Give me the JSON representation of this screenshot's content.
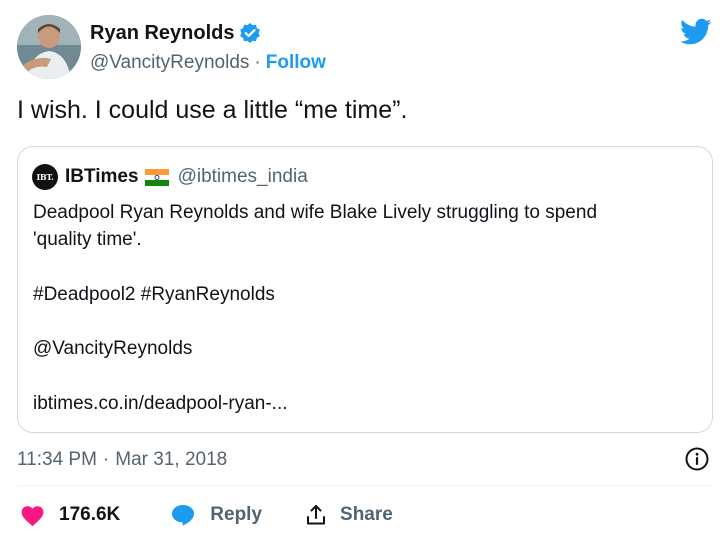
{
  "author": {
    "display_name": "Ryan Reynolds",
    "handle": "@VancityReynolds",
    "separator": "·",
    "follow_label": "Follow"
  },
  "tweet": {
    "text": "I wish. I could use a little “me time”."
  },
  "quoted": {
    "logo_text": "IBT.",
    "name": "IBTimes",
    "handle": "@ibtimes_india",
    "line1": "Deadpool Ryan Reynolds and wife Blake Lively struggling to spend",
    "line2": "'quality time'.",
    "hashtags": "#Deadpool2 #RyanReynolds",
    "mention": "@VancityReynolds",
    "link": "ibtimes.co.in/deadpool-ryan-..."
  },
  "meta": {
    "time": "11:34 PM",
    "separator": "·",
    "date": "Mar 31, 2018"
  },
  "actions": {
    "like_count": "176.6K",
    "reply_label": "Reply",
    "share_label": "Share"
  },
  "colors": {
    "accent": "#1d9bf0",
    "like": "#f91880",
    "text": "#0f1419",
    "muted": "#536471",
    "border": "#cfd9de"
  },
  "icons": [
    "avatar-photo",
    "verified-badge-icon",
    "twitter-bird-icon",
    "india-flag-icon",
    "info-icon",
    "heart-icon",
    "reply-bubble-icon",
    "share-icon"
  ]
}
